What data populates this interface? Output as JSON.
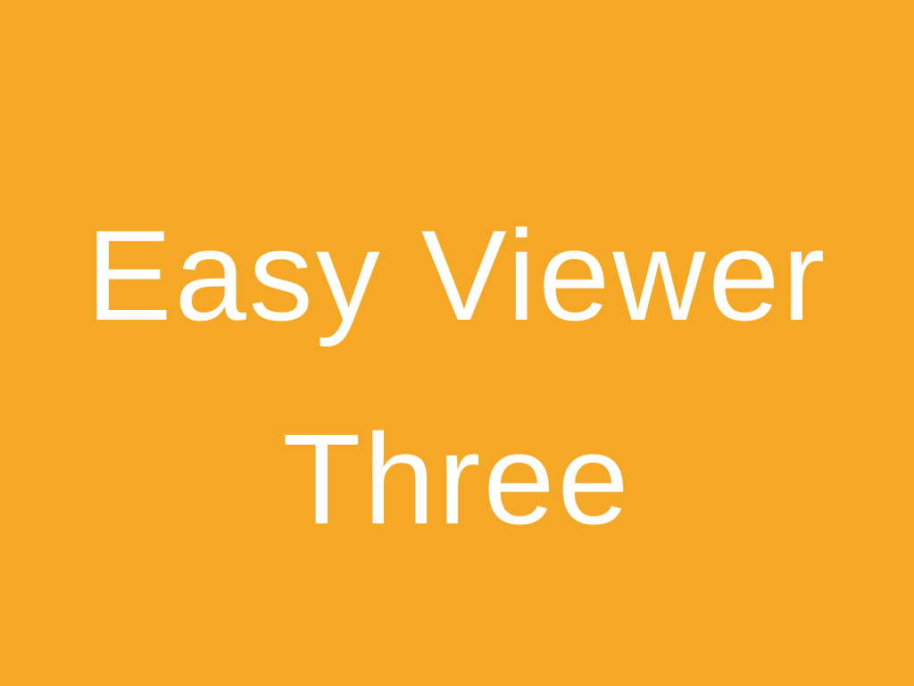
{
  "title": {
    "line1": "Easy Viewer",
    "line2": "Three"
  },
  "colors": {
    "background": "#F4A825",
    "text": "#FFFFFF"
  }
}
